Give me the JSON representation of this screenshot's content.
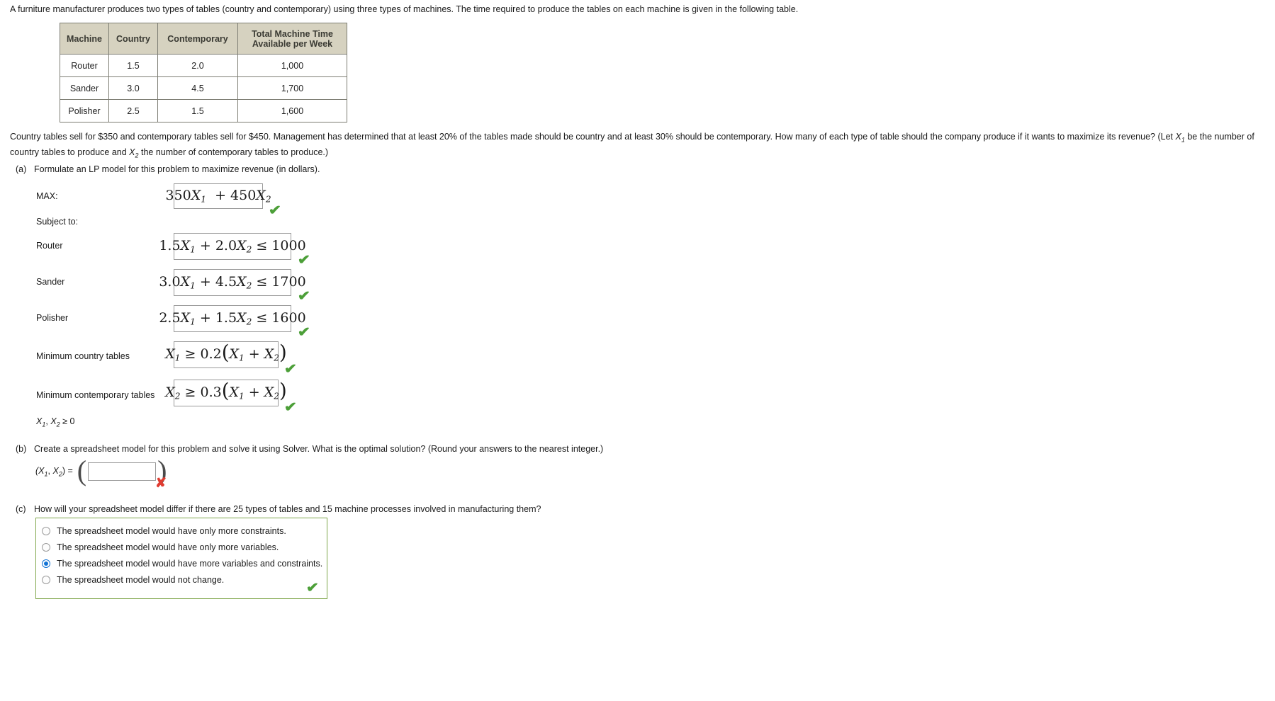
{
  "intro": {
    "text": "A furniture manufacturer produces two types of tables (country and contemporary) using three types of machines. The time required to produce the tables on each machine is given in the following table."
  },
  "machine_table": {
    "headers": [
      "Machine",
      "Country",
      "Contemporary",
      "Total Machine Time Available per Week"
    ],
    "header_total_line1": "Total Machine Time",
    "header_total_line2": "Available per Week",
    "rows": [
      {
        "machine": "Router",
        "country": "1.5",
        "contemporary": "2.0",
        "total": "1,000",
        "total_red": false
      },
      {
        "machine": "Sander",
        "country": "3.0",
        "contemporary": "4.5",
        "total": "1,700",
        "total_red": true
      },
      {
        "machine": "Polisher",
        "country": "2.5",
        "contemporary": "1.5",
        "total": "1,600",
        "total_red": true
      }
    ]
  },
  "problem": {
    "line1": "Country tables sell for $350 and contemporary tables sell for $450. Management has determined that at least 20% of the tables made should be country and at least 30% should be contemporary. How many of each type of table should the company produce if it wants",
    "line2_pre": "to maximize its revenue? (Let ",
    "line2_x1": "X",
    "line2_x1_sub": "1",
    "line2_mid": " be the number of country tables to produce and ",
    "line2_x2": "X",
    "line2_x2_sub": "2",
    "line2_post": " the number of contemporary tables to produce.)"
  },
  "part_a": {
    "label": "(a)",
    "prompt": "Formulate an LP model for this problem to maximize revenue (in dollars).",
    "max_caption": "MAX:",
    "subject_caption": "Subject to:",
    "objective": {
      "value": "350X1 + 450X2",
      "status": "correct"
    },
    "constraints": [
      {
        "caption": "Router",
        "value": "1.5X1 + 2.0X2 ≤ 1000",
        "status": "correct"
      },
      {
        "caption": "Sander",
        "value": "3.0X1 + 4.5X2 ≤ 1700",
        "status": "correct"
      },
      {
        "caption": "Polisher",
        "value": "2.5X1 + 1.5X2 ≤ 1600",
        "status": "correct"
      },
      {
        "caption": "Minimum country tables",
        "value": "X1 ≥ 0.2(X1 + X2)",
        "status": "correct"
      },
      {
        "caption": "Minimum contemporary tables",
        "value": "X2 ≥ 0.3(X1 + X2)",
        "status": "correct"
      }
    ],
    "nonnegativity": "X1, X2 ≥ 0"
  },
  "part_b": {
    "label": "(b)",
    "prompt": "Create a spreadsheet model for this problem and solve it using Solver. What is the optimal solution? (Round your answers to the nearest integer.)",
    "answer_label": "(X1, X2) =",
    "input_value": "",
    "input_placeholder": "",
    "status": "incorrect"
  },
  "part_c": {
    "label": "(c)",
    "prompt": "How will your spreadsheet model differ if there are 25 types of tables and 15 machine processes involved in manufacturing them?",
    "options": [
      {
        "label": "The spreadsheet model would have only more constraints.",
        "selected": false
      },
      {
        "label": "The spreadsheet model would have only more variables.",
        "selected": false
      },
      {
        "label": "The spreadsheet model would have more variables and constraints.",
        "selected": true
      },
      {
        "label": "The spreadsheet model would not change.",
        "selected": false
      }
    ],
    "status": "correct"
  },
  "icons": {
    "check": "✔",
    "cross": "✘"
  },
  "colors": {
    "check_green": "#4c9f38",
    "cross_red": "#e03c31",
    "table_header_bg": "#d6d2c0",
    "table_value_red": "#cc0000",
    "radio_blue": "#1273d4",
    "choice_border_green": "#7fa64b"
  }
}
